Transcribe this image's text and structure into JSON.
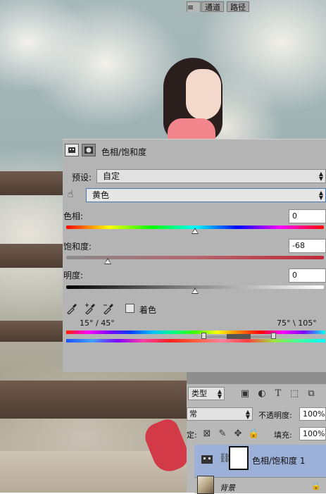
{
  "properties_panel": {
    "title": "色相/饱和度",
    "preset_label": "预设:",
    "preset_value": "自定",
    "channel_value": "黄色",
    "hue_label": "色相:",
    "hue_value": "0",
    "saturation_label": "饱和度:",
    "saturation_value": "-68",
    "lightness_label": "明度:",
    "lightness_value": "0",
    "colorize_label": "着色",
    "range_left": "15° / 45°",
    "range_right": "75° \\ 105°"
  },
  "layers_panel": {
    "tabs": [
      "通道",
      "路径"
    ],
    "filter_kind": "类型",
    "blend_mode": "常",
    "opacity_label": "不透明度:",
    "opacity_value": "100%",
    "lock_label": "定:",
    "fill_label": "填充:",
    "fill_value": "100%",
    "layers": [
      {
        "name": "色相/饱和度 1"
      },
      {
        "name": "背景"
      }
    ]
  },
  "icons": {
    "adjustment": "adjustment-icon",
    "mask": "mask-icon",
    "target_adjust": "hand-target-icon",
    "eyedropper": "eyedropper-icon",
    "eyedropper_plus": "eyedropper-add-icon",
    "eyedropper_minus": "eyedropper-subtract-icon",
    "link": "chain-link-icon",
    "lock": "lock-icon"
  }
}
